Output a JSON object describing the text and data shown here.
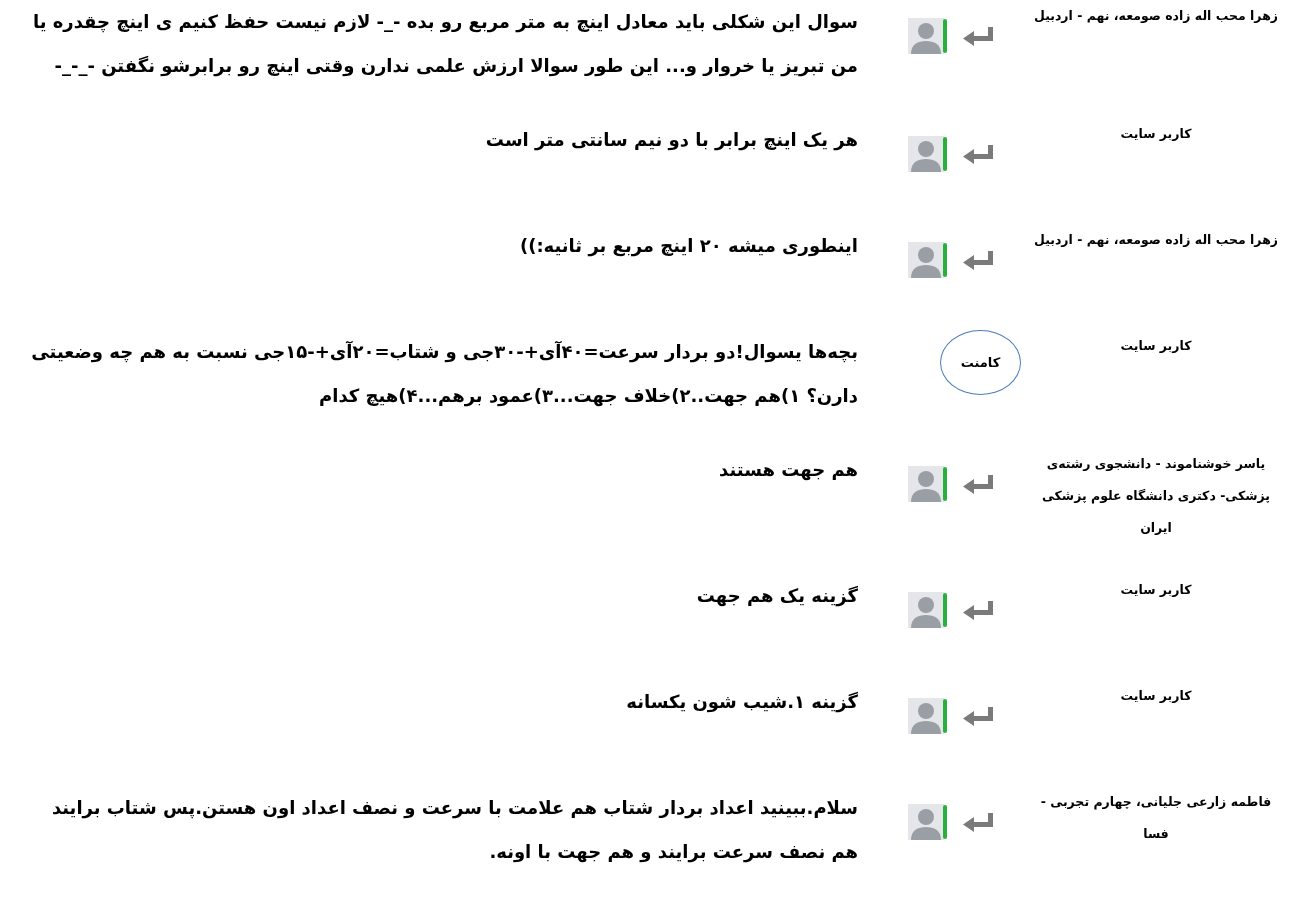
{
  "comments": [
    {
      "author": "زهرا محب اله زاده صومعه، نهم - اردبیل",
      "kind": "reply",
      "text": "سوال این شکلی باید معادل اینچ به متر مربع رو بده -_- لازم نیست حفظ کنیم ی اینچ چقدره یا من تبریز یا خروار و... این طور سوالا ارزش علمی ندارن وقتی اینچ رو برابرشو نگفتن -_-_-"
    },
    {
      "author": "کاربر سایت",
      "kind": "reply",
      "text": "هر یک اینچ برابر با دو نیم سانتی متر است"
    },
    {
      "author": "زهرا محب اله زاده صومعه، نهم - اردبیل",
      "kind": "reply",
      "text": "اینطوری میشه ۲۰ اینچ مربع بر ثانیه:))"
    },
    {
      "author": "کاربر سایت",
      "kind": "tag",
      "label": "کامنت",
      "text": "بچه‌ها یسوال!دو بردار سرعت=۴۰آی+-۳۰جی و  شتاب=۲۰آی+-۱۵جی نسبت به هم چه وضعیتی دارن؟ ۱)هم جهت..۲)خلاف جهت...۳)عمود برهم...۴)هیچ کدام"
    },
    {
      "author": "یاسر خوشناموند - دانشجوی رشته‌ی پزشکی- دکتری دانشگاه علوم پزشکی ایران",
      "kind": "reply",
      "text": "هم جهت هستند"
    },
    {
      "author": "کاربر سایت",
      "kind": "reply",
      "text": "گزینه یک هم جهت"
    },
    {
      "author": "کاربر سایت",
      "kind": "reply",
      "text": "گزینه ۱.شیب شون یکسانه"
    },
    {
      "author": "فاطمه زارعی جلیانی، چهارم تجربی - فسا",
      "kind": "reply",
      "text": "سلام.ببینید اعداد بردار شتاب هم علامت با سرعت و نصف اعداد اون هستن.پس شتاب برایند هم نصف سرعت برایند و هم جهت با اونه."
    }
  ]
}
